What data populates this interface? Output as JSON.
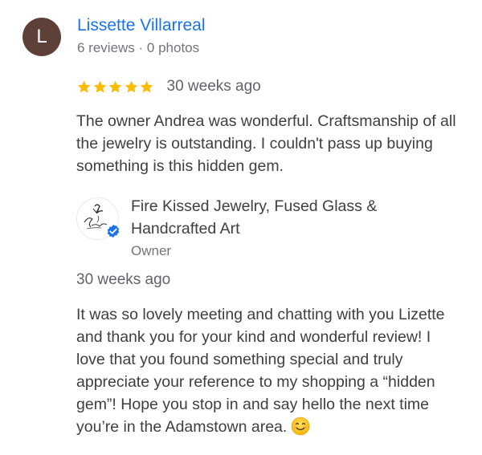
{
  "review": {
    "avatar_initial": "L",
    "avatar_color": "#5d4037",
    "reviewer_name": "Lissette Villarreal",
    "reviewer_meta": "6 reviews · 0 photos",
    "rating": 5,
    "rating_max": 5,
    "star_color": "#fbbc04",
    "date": "30 weeks ago",
    "text": "The owner Andrea was wonderful. Craftsmanship of all the jewelry is outstanding. I couldn't pass up buying something is this hidden gem."
  },
  "owner_reply": {
    "business_name": "Fire Kissed Jewelry, Fused Glass & Handcrafted Art",
    "role": "Owner",
    "logo_icon": "business-logo-icon",
    "verified_icon": "verified-check-icon",
    "verified_color": "#1a73e8",
    "date": "30 weeks ago",
    "text": "It was so lovely meeting and chatting with you Lizette and thank you for your kind and wonderful review! I love that you found something special and truly appreciate your reference to my shopping a “hidden gem”! Hope you stop in and say hello the next time you’re in the Adamstown area.",
    "emoji_icon": "smiling-face-emoji-icon"
  }
}
